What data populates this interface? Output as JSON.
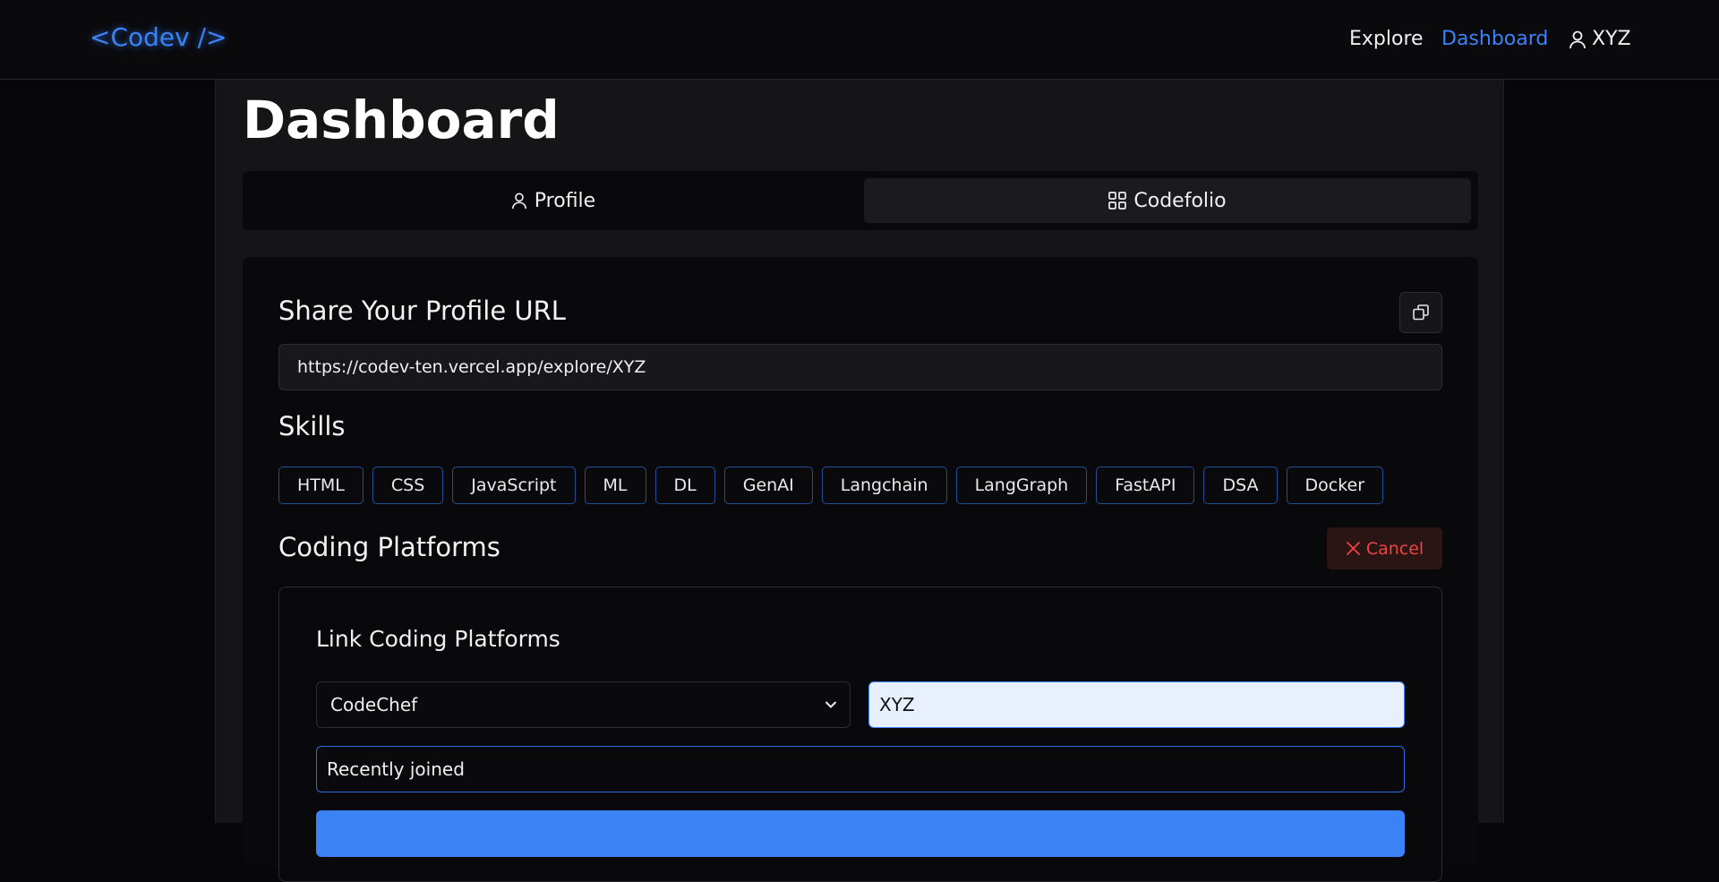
{
  "navbar": {
    "logo": "<Codev />",
    "explore": "Explore",
    "dashboard": "Dashboard",
    "username": "XYZ",
    "icons": {
      "user": "user-icon"
    }
  },
  "page": {
    "title": "Dashboard"
  },
  "tabs": [
    {
      "label": "Profile",
      "icon": "user-icon"
    },
    {
      "label": "Codefolio",
      "icon": "grid-icon",
      "active": true
    }
  ],
  "share": {
    "title": "Share Your Profile URL",
    "url": "https://codev-ten.vercel.app/explore/XYZ",
    "copy_icon": "copy-icon"
  },
  "skills": {
    "title": "Skills",
    "items": [
      "HTML",
      "CSS",
      "JavaScript",
      "ML",
      "DL",
      "GenAI",
      "Langchain",
      "LangGraph",
      "FastAPI",
      "DSA",
      "Docker"
    ]
  },
  "coding_platforms": {
    "title": "Coding Platforms",
    "cancel_label": "Cancel",
    "link_form": {
      "title": "Link Coding Platforms",
      "selected_platform": "CodeChef",
      "username_value": "XYZ",
      "status_value": "Recently joined"
    }
  },
  "colors": {
    "accent": "#3b82f6",
    "danger": "#ef4444",
    "background": "#07070b",
    "panel": "#151518"
  }
}
